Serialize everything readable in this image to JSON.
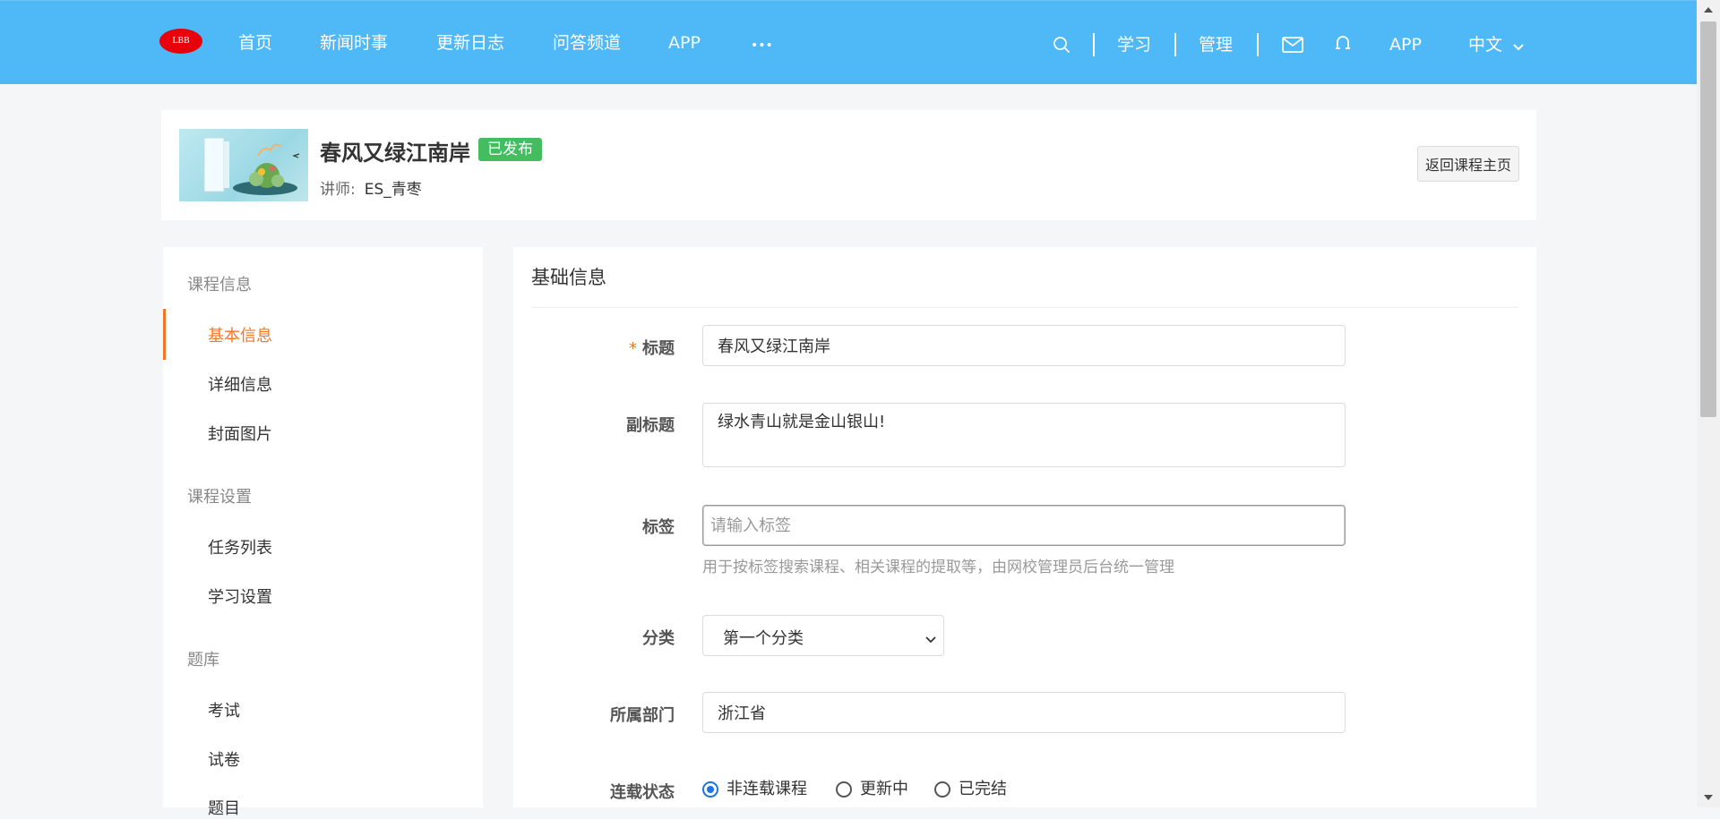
{
  "header": {
    "logo_text": "LBB",
    "nav": [
      {
        "label": "首页"
      },
      {
        "label": "新闻时事"
      },
      {
        "label": "更新日志"
      },
      {
        "label": "问答频道"
      },
      {
        "label": "APP"
      },
      {
        "label": "•••"
      }
    ],
    "right": {
      "study_label": "学习",
      "manage_label": "管理",
      "app_label": "APP",
      "language_label": "中文"
    }
  },
  "course": {
    "title": "春风又绿江南岸",
    "status_badge": "已发布",
    "teacher_label": "讲师:",
    "teacher_name": "ES_青枣",
    "back_button": "返回课程主页"
  },
  "sidebar": {
    "groups": [
      {
        "title": "课程信息",
        "items": [
          "基本信息",
          "详细信息",
          "封面图片"
        ]
      },
      {
        "title": "课程设置",
        "items": [
          "任务列表",
          "学习设置"
        ]
      },
      {
        "title": "题库",
        "items": [
          "考试",
          "试卷",
          "题目"
        ]
      }
    ]
  },
  "form": {
    "section_title": "基础信息",
    "title_label": "标题",
    "title_value": "春风又绿江南岸",
    "subtitle_label": "副标题",
    "subtitle_value": "绿水青山就是金山银山!",
    "tags_label": "标签",
    "tags_placeholder": "请输入标签",
    "tags_help": "用于按标签搜索课程、相关课程的提取等，由网校管理员后台统一管理",
    "category_label": "分类",
    "category_value": "第一个分类",
    "department_label": "所属部门",
    "department_value": "浙江省",
    "serial_label": "连载状态",
    "serial_options": [
      "非连载课程",
      "更新中",
      "已完结"
    ],
    "serial_selected": "非连载课程"
  },
  "colors": {
    "header_bg": "#4fb8f7",
    "accent_orange": "#f0772a",
    "badge_green": "#43bd5f",
    "radio_blue": "#1a73e8"
  },
  "icons": {
    "search": "search-icon",
    "mail": "mail-icon",
    "notification": "bell-icon",
    "dropdown": "chevron-down-icon"
  }
}
